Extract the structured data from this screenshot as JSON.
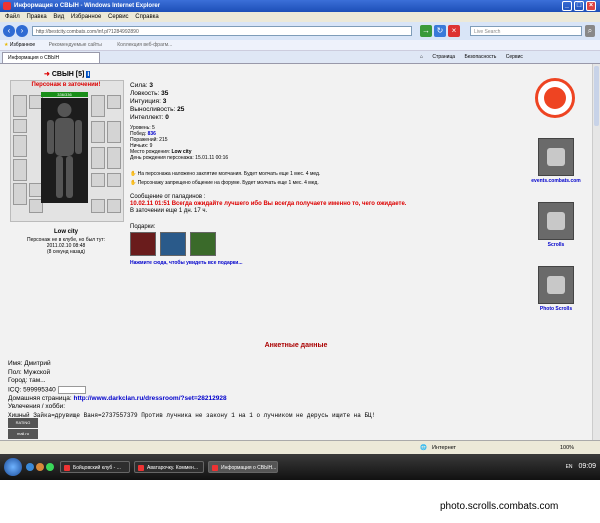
{
  "window": {
    "title": "Информация о СВЫН - Windows Internet Explorer"
  },
  "menu": [
    "Файл",
    "Правка",
    "Вид",
    "Избранное",
    "Сервис",
    "Справка"
  ],
  "address": {
    "url": "http://bestcity.combats.com/inf.pl?1284992890",
    "search_placeholder": "Live Search"
  },
  "favorites": {
    "label": "Избранное",
    "items": [
      "Рекомендуемые сайты",
      "Коллекция веб-фрагм..."
    ]
  },
  "tab": {
    "label": "Информация о СВЫН"
  },
  "toolbar_right": [
    "Страница",
    "Безопасность",
    "Сервис"
  ],
  "character": {
    "name": "СВЫН [5]",
    "status": "Персонаж в заточении!",
    "hp": "336/336",
    "location": "Low city",
    "online_note": "Персонаж не в клубе, но был тут:",
    "last_seen": "2011.02.10 08:48",
    "ago": "(8 секунд назад)"
  },
  "stats": [
    {
      "label": "Сила:",
      "value": "3"
    },
    {
      "label": "Ловкость:",
      "value": "35"
    },
    {
      "label": "Интуиция:",
      "value": "3"
    },
    {
      "label": "Выносливость:",
      "value": "25"
    },
    {
      "label": "Интеллект:",
      "value": "0"
    }
  ],
  "info": {
    "level": "Уровень: 5",
    "wins_label": "Побед:",
    "wins": "836",
    "losses": "Поражений: 215",
    "draws": "Ничьих: 9",
    "birthplace_label": "Место рождения:",
    "birthplace": "Low city",
    "birthday": "День рождения персонажа: 15.01.11 00:16"
  },
  "notices": [
    "На персонажа наложено заклятие молчания. Будет молчать еще 1 мес. 4 мед.",
    "Персонажу запрещено общение на форуме. Будет молчать еще 1 мес. 4 мед."
  ],
  "paladins": {
    "label": "Сообщение от паладинов :",
    "message": "10.02.11 01:51 Всегда ожидайте лучшего ибо Вы всегда получаете именно то, чего ожидаете.",
    "prison": "В заточении еще 1 дн. 17 ч."
  },
  "gifts": {
    "label": "Подарки:",
    "link": "Нажмите сюда, чтобы увидеть все подарки..."
  },
  "right_links": [
    "events.combats.com",
    "Scrolls",
    "Photo Scrolls"
  ],
  "profile": {
    "title": "Анкетные данные",
    "name": "Имя: Дмитрий",
    "gender": "Пол: Мужской",
    "city": "Город: там...",
    "icq": "ICQ: 599995340",
    "homepage_label": "Домашняя страница:",
    "homepage": "http://www.darkclan.ru/dressroom/?set=28212928",
    "hobby": "Увлечения / хобби:",
    "hobby_text": "Хишный Зайка=друвище              Ваня=2737557379         Против лучника не закону 1 на 1 о лучником не дерусь ищите на БЦ!"
  },
  "counters": [
    "RATING",
    "mail.ru"
  ],
  "statusbar": {
    "zone": "Интернет",
    "zoom": "100%"
  },
  "taskbar": {
    "tasks": [
      "Бойцовский клуб - ...",
      "Аватарочку. Коммен...",
      "Информация о СВЫН..."
    ],
    "lang": "EN",
    "clock": "09:09"
  },
  "watermark": "photo.scrolls.combats.com",
  "colors": {
    "accent_red": "#dd0000",
    "link_blue": "#0000cc",
    "titlebar": "#1d4fb7"
  }
}
